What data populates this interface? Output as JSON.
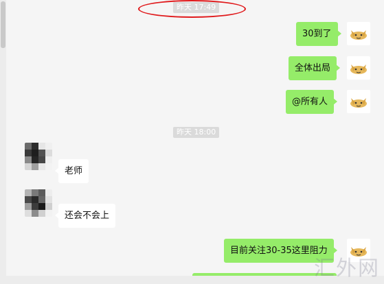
{
  "chat": {
    "timestamps": [
      "昨天 17:49",
      "昨天 18:00"
    ],
    "messages": [
      {
        "side": "me",
        "text": "30到了"
      },
      {
        "side": "me",
        "text": "全体出局"
      },
      {
        "side": "me",
        "text": "@所有人"
      },
      {
        "side": "other",
        "text": "老师"
      },
      {
        "side": "other",
        "text": "还会不会上"
      },
      {
        "side": "me",
        "text": "目前关注30-35这里阻力"
      }
    ]
  },
  "watermark": "汇外网",
  "colors": {
    "bubble_me": "#95ec69",
    "bubble_other": "#ffffff",
    "background": "#f5f5f5",
    "annotation_ring": "#e0191b"
  }
}
